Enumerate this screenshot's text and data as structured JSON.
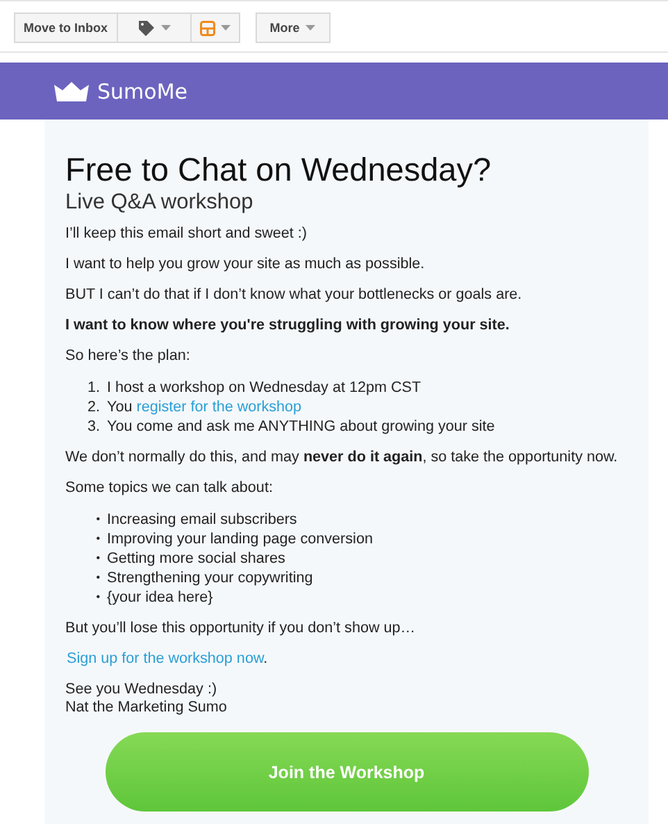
{
  "toolbar": {
    "buttons": [
      {
        "kind": "text",
        "label": "Move to Inbox"
      },
      {
        "kind": "tag"
      },
      {
        "kind": "layout"
      }
    ],
    "more": "More"
  },
  "brand": {
    "name": "SumoMe"
  },
  "email": {
    "title": "Free to Chat on Wednesday?",
    "subtitle": "Live Q&A workshop",
    "blocks": [
      {
        "kind": "paragraph",
        "text": "I’ll keep this email short and sweet :)"
      },
      {
        "kind": "paragraph",
        "text": "I want to help you grow your site as much as possible."
      },
      {
        "kind": "paragraph",
        "text": "BUT I can’t do that if I don’t know what your bottlenecks or goals are."
      },
      {
        "kind": "strong",
        "text": "I want to know where you're struggling with growing your site."
      },
      {
        "kind": "paragraph",
        "text": "So here’s the plan:"
      },
      {
        "kind": "ordered",
        "items": [
          {
            "marker": "1.",
            "text": "I host a workshop on Wednesday at 12pm CST"
          },
          {
            "marker": "2.",
            "text": "You",
            "link": "register for the workshop"
          },
          {
            "marker": "3.",
            "text": "You come and ask me ANYTHING about growing your site"
          }
        ]
      },
      {
        "kind": "paragraph",
        "text": "We don’t normally do this, and may **never do it again**, so take the opportunity now."
      },
      {
        "kind": "paragraph",
        "text": "Some topics we can talk about:"
      },
      {
        "kind": "bullets",
        "items": [
          {
            "marker": "•",
            "text": "Increasing email subscribers"
          },
          {
            "marker": "•",
            "text": "Improving your landing page conversion"
          },
          {
            "marker": "•",
            "text": "Getting more social shares"
          },
          {
            "marker": "•",
            "text": "Strengthening your copywriting"
          },
          {
            "marker": "•",
            "text": "{your idea here}"
          }
        ]
      },
      {
        "kind": "paragraph",
        "text": "But you’ll lose this opportunity if you don’t show up…"
      },
      {
        "kind": "link",
        "link": "Sign up for the workshop now",
        "text": "."
      },
      {
        "kind": "lines",
        "lines": [
          "See you Wednesday :)",
          "Nat the Marketing Sumo"
        ]
      }
    ],
    "cta": "Join the Workshop"
  }
}
